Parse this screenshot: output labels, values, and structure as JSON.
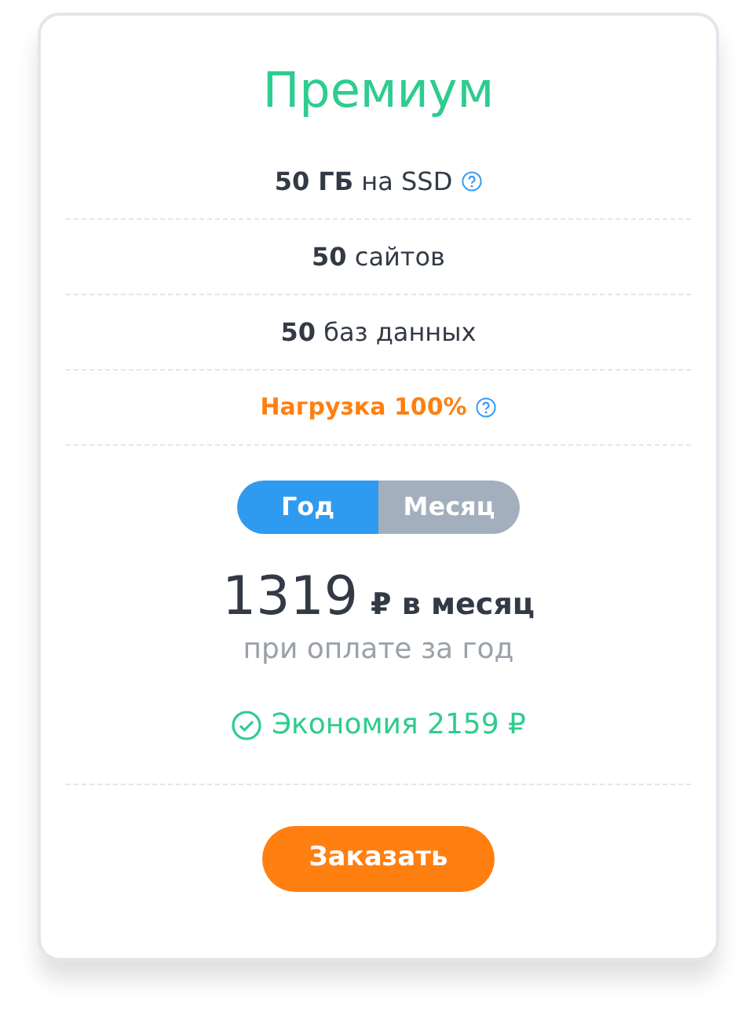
{
  "plan": {
    "title": "Премиум",
    "features": [
      {
        "text": "**50 ГБ** на SSD",
        "help": true,
        "kind": "normal"
      },
      {
        "text": "**50** сайтов",
        "help": false,
        "kind": "normal"
      },
      {
        "text": "**50** баз данных",
        "help": false,
        "kind": "normal"
      },
      {
        "text": "Нагрузка 100%",
        "help": true,
        "kind": "load"
      }
    ],
    "periods": [
      {
        "label": "Год",
        "selected": true
      },
      {
        "label": "Месяц",
        "selected": false
      }
    ],
    "price": "1319",
    "price_unit": "₽ в месяц",
    "price_note": "при оплате за год",
    "saving": "Экономия 2159 ₽",
    "order_button": "Заказать"
  }
}
